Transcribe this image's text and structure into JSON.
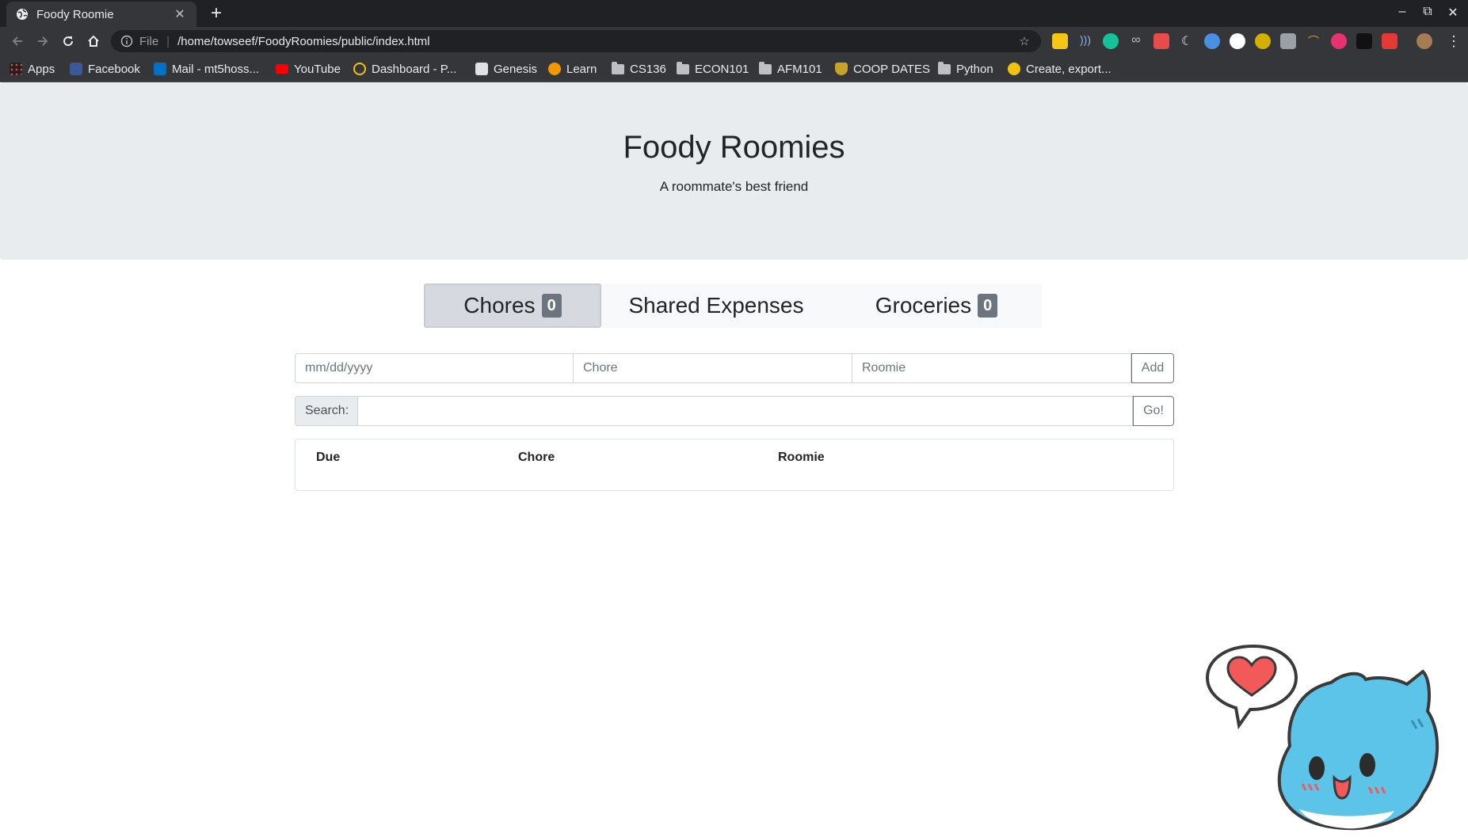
{
  "browser": {
    "tab_title": "Foody Roomie",
    "url_scheme": "File",
    "url": "/home/towseef/FoodyRoomies/public/index.html",
    "bookmarks": [
      {
        "label": "Apps",
        "icon": "apps-grid-icon"
      },
      {
        "label": "Facebook",
        "icon": "facebook-icon"
      },
      {
        "label": "Mail - mt5hoss...",
        "icon": "outlook-icon"
      },
      {
        "label": "YouTube",
        "icon": "youtube-icon"
      },
      {
        "label": "Dashboard - P...",
        "icon": "dashboard-icon"
      },
      {
        "label": "Genesis",
        "icon": "genesis-icon"
      },
      {
        "label": "Learn",
        "icon": "learn-icon"
      },
      {
        "label": "CS136",
        "icon": "folder-icon"
      },
      {
        "label": "ECON101",
        "icon": "folder-icon"
      },
      {
        "label": "AFM101",
        "icon": "folder-icon"
      },
      {
        "label": "COOP DATES",
        "icon": "shield-crest-icon"
      },
      {
        "label": "Python",
        "icon": "folder-icon"
      },
      {
        "label": "Create, export...",
        "icon": "create-export-icon"
      }
    ]
  },
  "header": {
    "title": "Foody Roomies",
    "subtitle": "A roommate's best friend"
  },
  "tabs": [
    {
      "label": "Chores",
      "badge": "0",
      "active": true
    },
    {
      "label": "Shared Expenses",
      "badge": null,
      "active": false
    },
    {
      "label": "Groceries",
      "badge": "0",
      "active": false
    }
  ],
  "add_form": {
    "date_placeholder": "mm/dd/yyyy",
    "chore_placeholder": "Chore",
    "roomie_placeholder": "Roomie",
    "add_label": "Add"
  },
  "search": {
    "label": "Search:",
    "go_label": "Go!"
  },
  "table": {
    "columns": [
      "Due",
      "Chore",
      "Roomie"
    ]
  },
  "colors": {
    "jumbotron_bg": "#e9ecef",
    "badge_bg": "#6c757d",
    "active_tab_bg": "#d6dae0",
    "mascot_blue": "#5cc4e8",
    "heart_red": "#f25a5a"
  }
}
